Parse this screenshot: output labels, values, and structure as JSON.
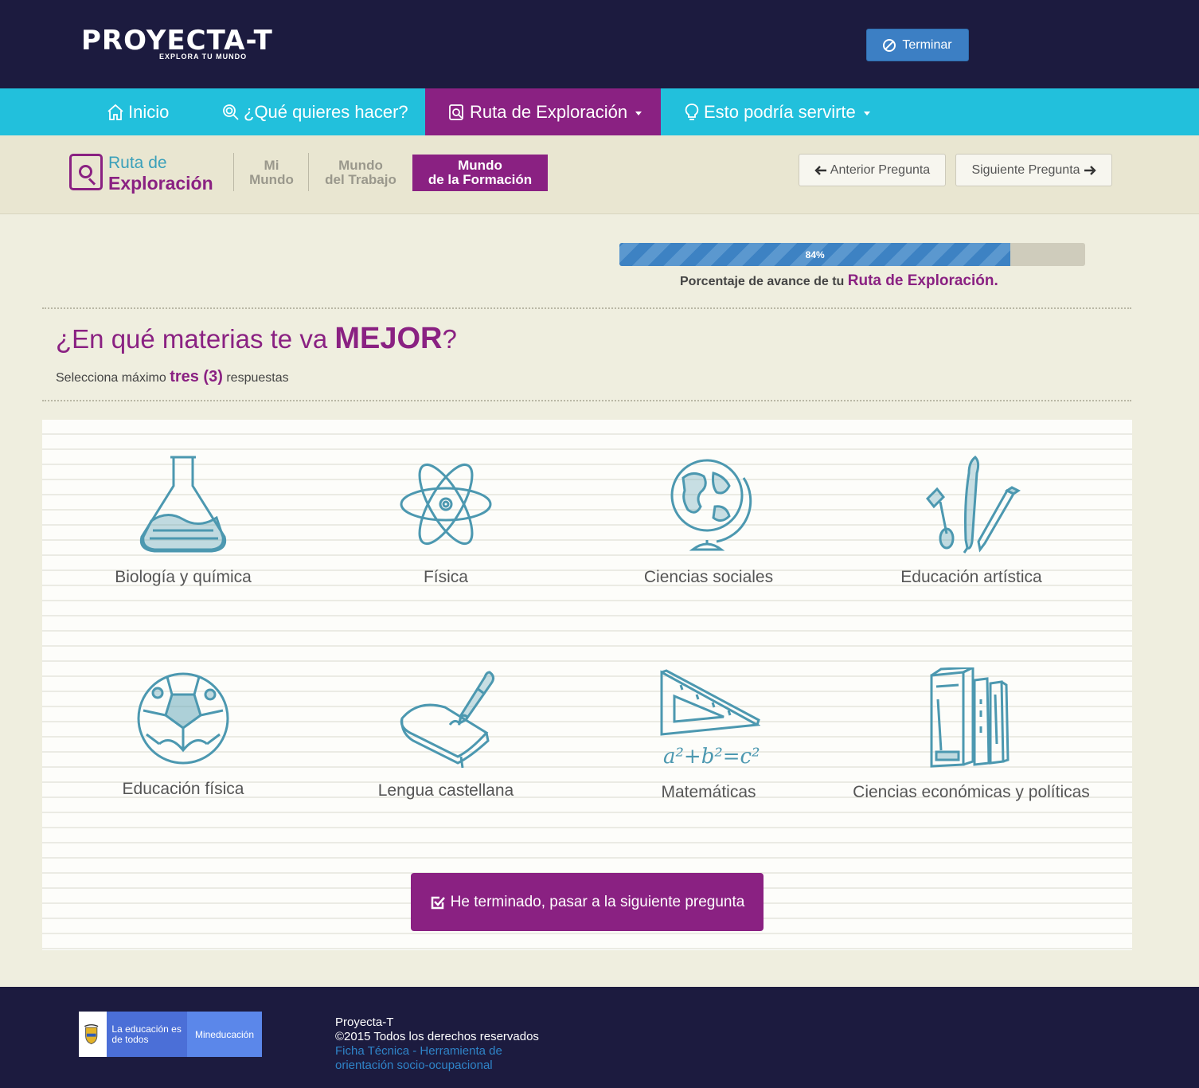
{
  "header": {
    "logo_text": "PROYECTA-T",
    "logo_subtitle": "EXPLORA TU MUNDO",
    "terminar_label": "Terminar",
    "terminar_icon": "ban-icon"
  },
  "nav": {
    "items": [
      {
        "label": "Inicio",
        "icon": "home-icon"
      },
      {
        "label": "¿Qué quieres hacer?",
        "icon": "search-icon"
      },
      {
        "label": "Ruta de Exploración",
        "icon": "search-doc-icon"
      },
      {
        "label": "Esto podría servirte",
        "icon": "lightbulb-icon"
      }
    ]
  },
  "subnav": {
    "title_line1": "Ruta de",
    "title_line2": "Exploración",
    "tabs": [
      {
        "line1": "Mi",
        "line2": "Mundo"
      },
      {
        "line1": "Mundo",
        "line2": "del Trabajo"
      },
      {
        "line1": "Mundo",
        "line2": "de la Formación"
      }
    ],
    "prev_label": "Anterior Pregunta",
    "next_label": "Siguiente Pregunta"
  },
  "progress": {
    "value": 0.84,
    "label": "84%",
    "caption_prefix": "Porcentaje de avance de tu",
    "caption_strong": "Ruta de Exploración."
  },
  "question": {
    "text_prefix": "¿En qué materias te va",
    "text_strong": "MEJOR",
    "text_suffix": "?",
    "instruction_prefix": "Selecciona máximo",
    "instruction_strong": "tres (3)",
    "instruction_suffix": "respuestas"
  },
  "options": [
    {
      "label": "Biología y química",
      "icon": "flask-icon"
    },
    {
      "label": "Física",
      "icon": "atom-icon"
    },
    {
      "label": "Ciencias sociales",
      "icon": "globe-icon"
    },
    {
      "label": "Educación artística",
      "icon": "art-brushes-icon"
    },
    {
      "label": "Educación física",
      "icon": "soccer-ball-icon"
    },
    {
      "label": "Lengua castellana",
      "icon": "book-pen-icon"
    },
    {
      "label": "Matemáticas",
      "icon": "set-square-icon",
      "formula": "a²+b²=c²"
    },
    {
      "label": "Ciencias económicas y políticas",
      "icon": "books-icon"
    }
  ],
  "finish_button": "He terminado, pasar a la siguiente pregunta",
  "footer": {
    "mined_left": "La educación es de todos",
    "mined_right": "Mineducación",
    "line1": "Proyecta-T",
    "line2": "©2015 Todos los derechos reservados",
    "link": "Ficha Técnica - Herramienta de orientación socio-ocupacional"
  },
  "colors": {
    "primary_purple": "#8a2182",
    "nav_cyan": "#22c0dc",
    "dark_navy": "#1c1b3f",
    "icon_teal": "#4c98b0",
    "progress_blue": "#3d82c3"
  }
}
